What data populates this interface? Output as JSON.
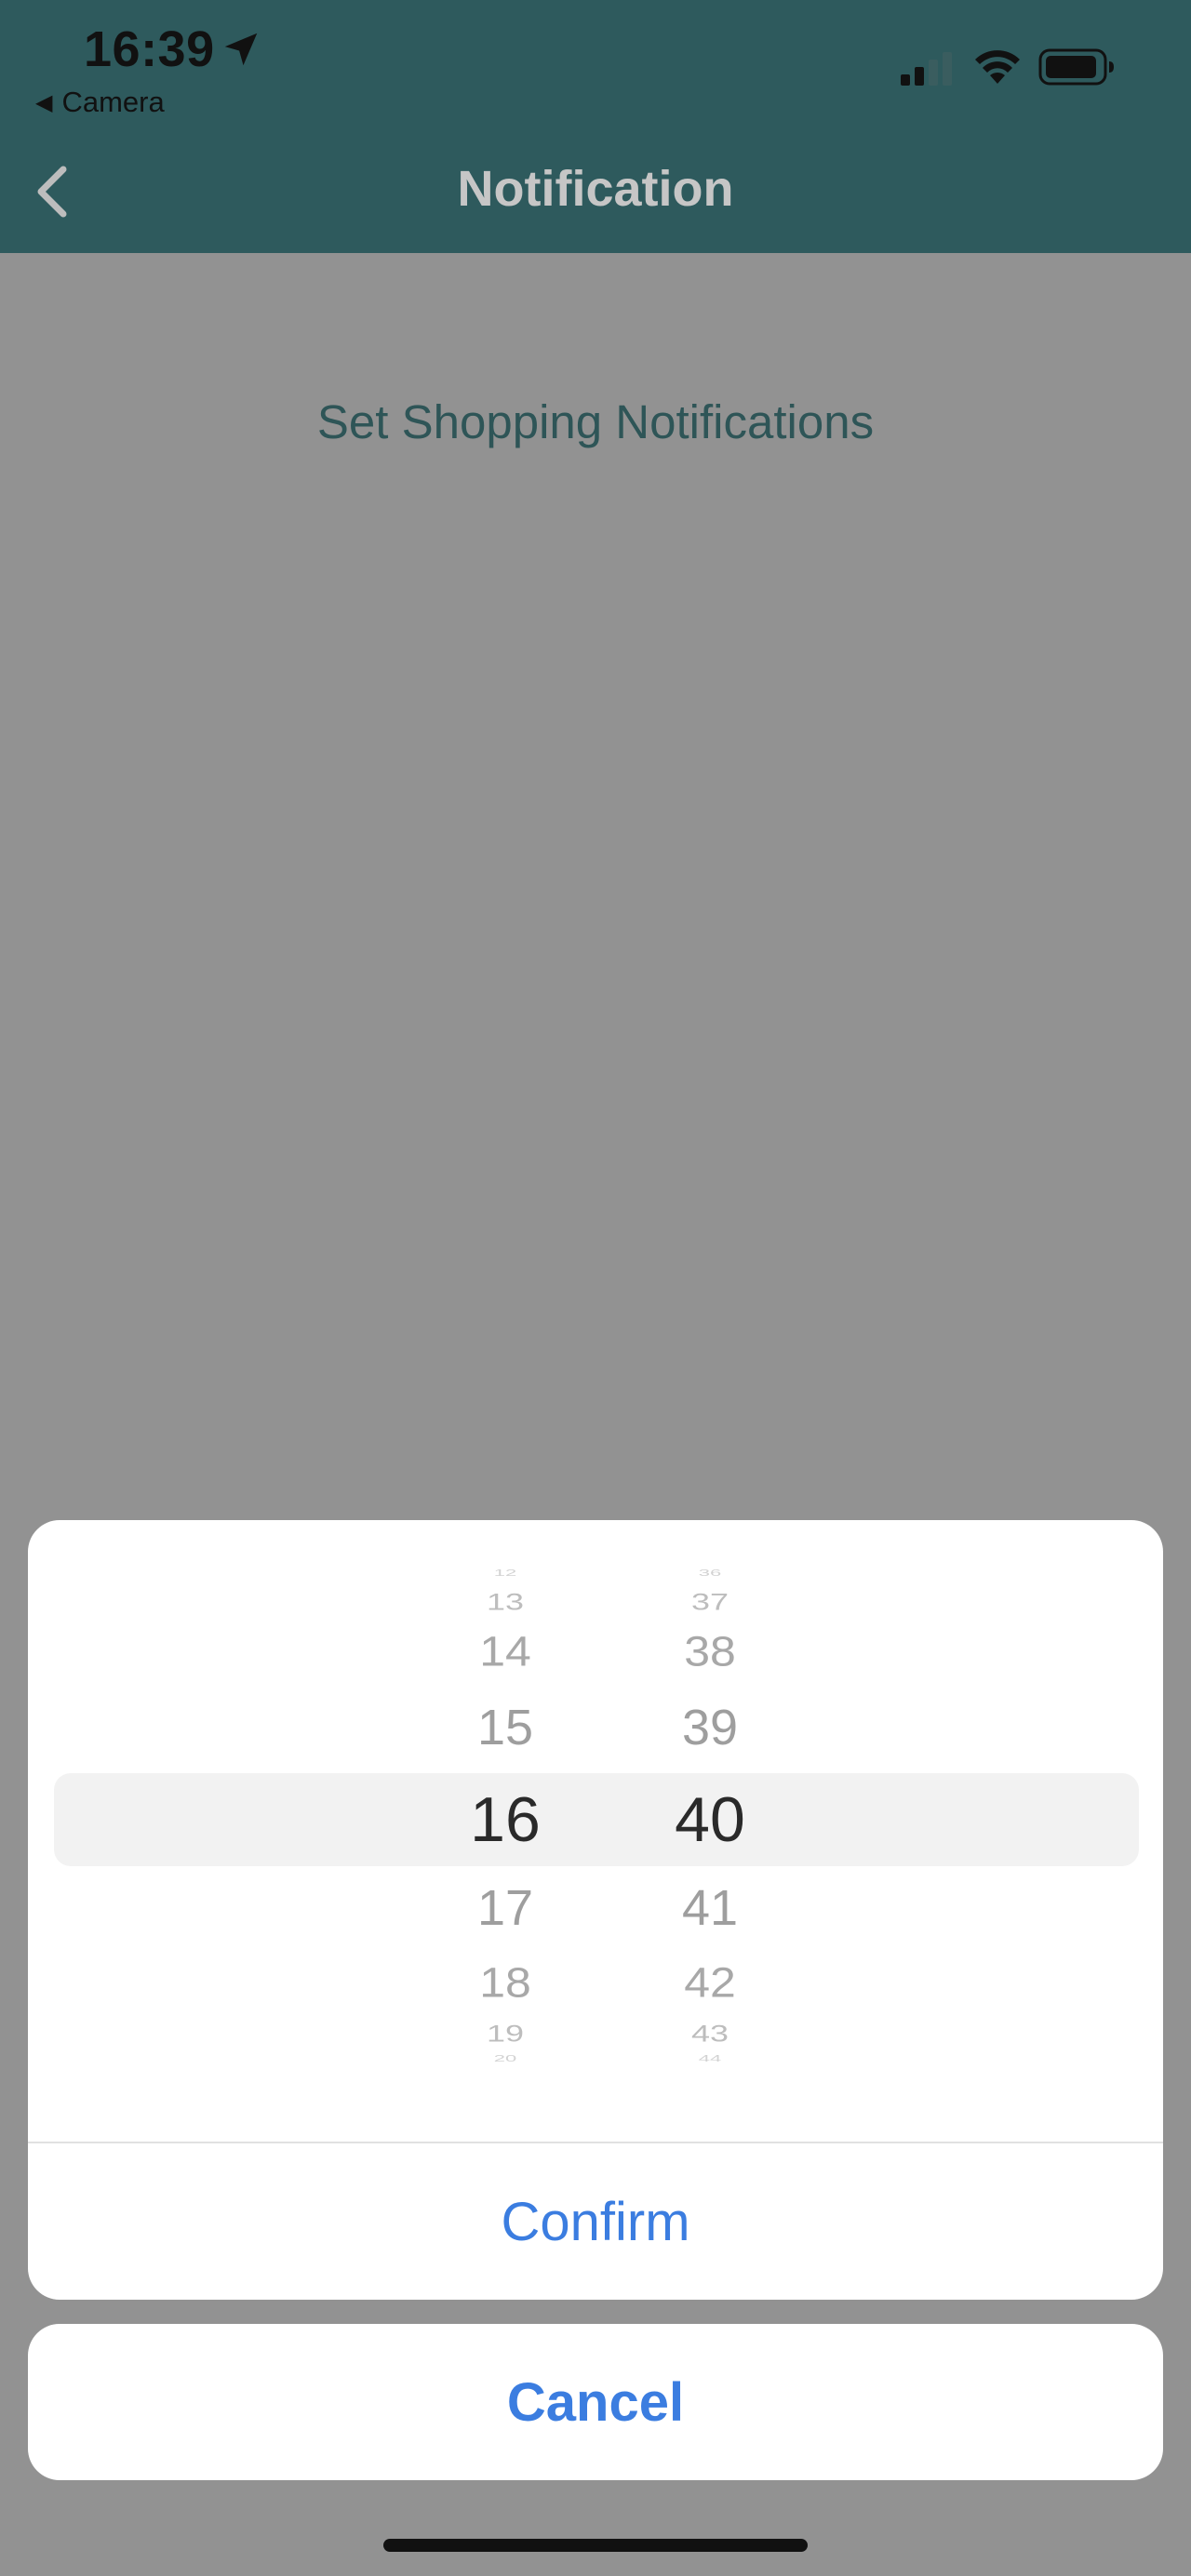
{
  "status_bar": {
    "time": "16:39",
    "back_app_label": "Camera",
    "icons": [
      "location-arrow-icon",
      "cellular-signal-icon",
      "wifi-icon",
      "battery-icon"
    ]
  },
  "nav": {
    "title": "Notification",
    "back_icon": "chevron-left-icon"
  },
  "content": {
    "subtitle": "Set Shopping Notifications"
  },
  "picker": {
    "hours": [
      "12",
      "13",
      "14",
      "15",
      "16",
      "17",
      "18",
      "19",
      "20"
    ],
    "minutes": [
      "36",
      "37",
      "38",
      "39",
      "40",
      "41",
      "42",
      "43",
      "44"
    ],
    "selected_hour": "16",
    "selected_minute": "40"
  },
  "actions": {
    "confirm_label": "Confirm",
    "cancel_label": "Cancel"
  },
  "colors": {
    "header_bg": "#2e5a5d",
    "overlay_bg": "#929292",
    "action_blue": "#3b7de0",
    "subtitle_text": "#2e5557"
  }
}
